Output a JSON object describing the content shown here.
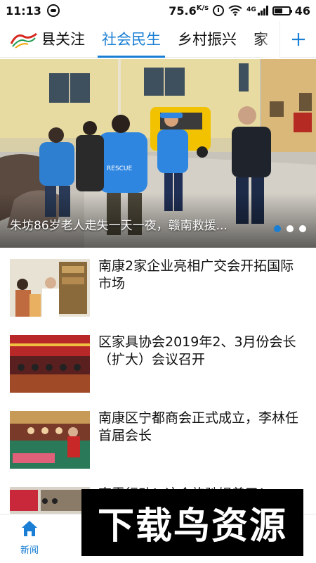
{
  "status_bar": {
    "time": "11:13",
    "speed": "75.6",
    "speed_unit": "K/s",
    "network": "4G",
    "battery": "46"
  },
  "category_nav": {
    "tabs": [
      "县关注",
      "社会民生",
      "乡村振兴",
      "家"
    ],
    "active_index": 1,
    "add_icon": "plus-icon",
    "accent_color": "#1a7fd4"
  },
  "hero": {
    "caption": "朱坊86岁老人走失一天一夜，赣南救援...",
    "slide_count": 3,
    "active_slide": 0
  },
  "news": [
    {
      "title": "南康2家企业亮相广交会开拓国际市场"
    },
    {
      "title": "区家具协会2019年2、3月份会长（扩大）会议召开"
    },
    {
      "title": "南康区宁都商会正式成立，李林任首届会长"
    },
    {
      "title": "南霄行动！这个旅驰娱着了！"
    }
  ],
  "bottom_nav": {
    "news_label": "新闻",
    "news_icon": "home-icon"
  },
  "watermark": {
    "text": "下载鸟资源"
  }
}
